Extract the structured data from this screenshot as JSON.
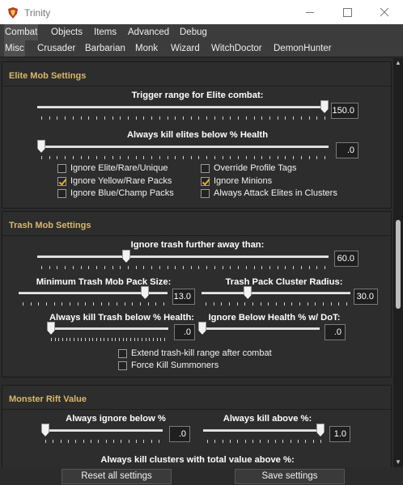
{
  "window": {
    "title": "Trinity"
  },
  "tabs_row1": [
    "Combat",
    "Objects",
    "Items",
    "Advanced",
    "Debug"
  ],
  "tabs_row2": [
    "Misc",
    "Crusader",
    "Barbarian",
    "Monk",
    "Wizard",
    "WitchDoctor",
    "DemonHunter"
  ],
  "elite": {
    "header": "Elite Mob Settings",
    "trigger_label": "Trigger range for Elite combat:",
    "trigger_value": "150.0",
    "trigger_fraction": 1.0,
    "health_label": "Always kill elites below % Health",
    "health_value": ".0",
    "health_fraction": 0.0,
    "checks": [
      {
        "label": "Ignore Elite/Rare/Unique",
        "checked": false
      },
      {
        "label": "Ignore Yellow/Rare Packs",
        "checked": true
      },
      {
        "label": "Ignore Blue/Champ Packs",
        "checked": false
      },
      {
        "label": "Override Profile Tags",
        "checked": false
      },
      {
        "label": "Ignore Minions",
        "checked": true
      },
      {
        "label": "Always Attack Elites in Clusters",
        "checked": false
      }
    ]
  },
  "trash": {
    "header": "Trash Mob Settings",
    "ignore_label": "Ignore trash further away than:",
    "ignore_value": "60.0",
    "ignore_fraction": 0.3,
    "pack_size_label": "Minimum Trash Mob Pack Size:",
    "pack_size_value": "13.0",
    "pack_size_fraction": 0.87,
    "cluster_label": "Trash Pack Cluster Radius:",
    "cluster_value": "30.0",
    "cluster_fraction": 0.3,
    "kill_below_label": "Always kill Trash below % Health:",
    "kill_below_value": ".0",
    "kill_below_fraction": 0.0,
    "dot_label": "Ignore Below Health % w/ DoT:",
    "dot_value": ".0",
    "dot_fraction": 0.0,
    "checks": [
      {
        "label": "Extend trash-kill range after combat",
        "checked": false
      },
      {
        "label": "Force Kill Summoners",
        "checked": false
      }
    ]
  },
  "rift": {
    "header": "Monster Rift Value",
    "ignore_below_label": "Always ignore below %",
    "ignore_below_value": ".0",
    "ignore_below_fraction": 0.0,
    "kill_above_label": "Always kill above %:",
    "kill_above_value": "1.0",
    "kill_above_fraction": 1.0,
    "clusters_label": "Always kill clusters with total value above %:"
  },
  "buttons": {
    "reset": "Reset all settings",
    "save": "Save settings"
  },
  "icons": {
    "app": "trinity-logo-icon",
    "minimize": "minimize-icon",
    "maximize": "maximize-icon",
    "close": "close-icon"
  }
}
